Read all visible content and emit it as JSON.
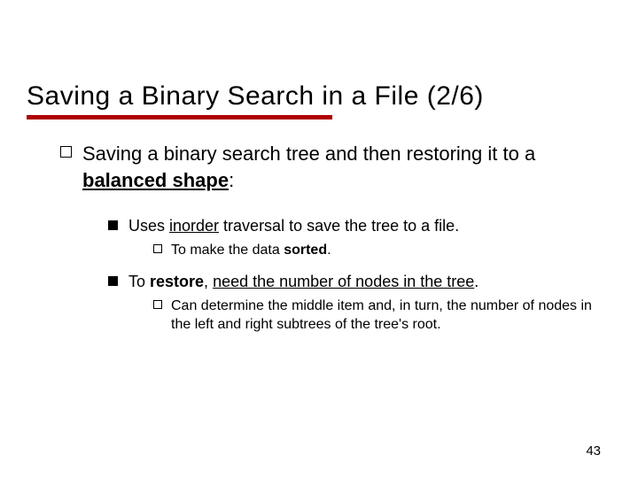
{
  "title": "Saving a Binary Search in a File (2/6)",
  "lvl1_prefix": "Saving a binary search tree and then restoring it to a ",
  "lvl1_emph": "balanced shape",
  "lvl1_suffix": ":",
  "p1_prefix": "Uses ",
  "p1_under": "inorder",
  "p1_suffix": " traversal to save the tree to a file.",
  "p1_sub_prefix": "To make the data ",
  "p1_sub_bold": "sorted",
  "p1_sub_suffix": ".",
  "p2_prefix": "To ",
  "p2_bold": "restore",
  "p2_mid": ", ",
  "p2_under": "need the number of nodes in the tree",
  "p2_suffix": ".",
  "p2_sub": "Can determine the middle item and, in turn, the number of nodes in the left and right subtrees of the tree's root.",
  "page": "43"
}
